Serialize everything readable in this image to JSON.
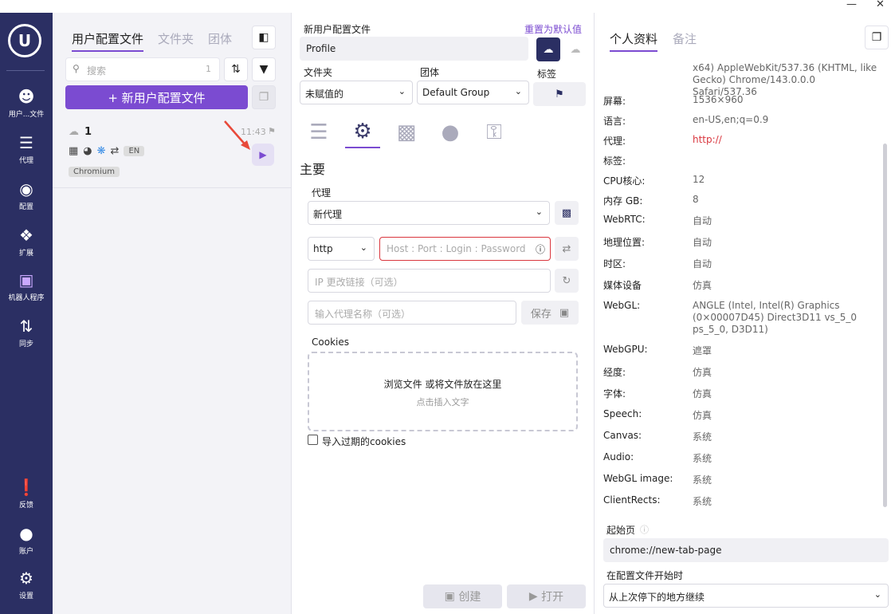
{
  "window": {
    "minimize": "—",
    "close": "✕"
  },
  "nav": {
    "items": [
      {
        "label": "用户...文件",
        "icon": "users-icon"
      },
      {
        "label": "代理",
        "icon": "proxy-icon"
      },
      {
        "label": "配置",
        "icon": "fingerprint-icon"
      },
      {
        "label": "扩展",
        "icon": "puzzle-icon"
      },
      {
        "label": "机器人程序",
        "icon": "lock-icon"
      },
      {
        "label": "同步",
        "icon": "sync-icon"
      },
      {
        "label": "反馈",
        "icon": "feedback-icon"
      },
      {
        "label": "账户",
        "icon": "account-icon"
      },
      {
        "label": "设置",
        "icon": "gear-icon"
      }
    ]
  },
  "profiles": {
    "tabs": [
      "用户配置文件",
      "文件夹",
      "团体"
    ],
    "search_placeholder": "搜索",
    "search_count": "1",
    "new_button": "+ 新用户配置文件",
    "card": {
      "name": "1",
      "time": "11:43",
      "lang_chip": "EN",
      "browser_chip": "Chromium"
    }
  },
  "editor": {
    "title_label": "新用户配置文件",
    "reset_link": "重置为默认值",
    "profile_name": "Profile",
    "folder_label": "文件夹",
    "folder_value": "未赋值的",
    "group_label": "团体",
    "group_value": "Default Group",
    "tag_label": "标签",
    "section_title": "主要",
    "proxy_label": "代理",
    "proxy_value": "新代理",
    "protocol": "http",
    "host_placeholder": "Host : Port : Login : Password",
    "ip_change_placeholder": "IP 更改链接（可选）",
    "proxy_name_placeholder": "输入代理名称（可选）",
    "save_label": "保存",
    "cookies_label": "Cookies",
    "drop_line1": "浏览文件 或将文件放在这里",
    "drop_line2": "点击插入文字",
    "import_expired": "导入过期的cookies",
    "create_label": "创建",
    "open_label": "打开"
  },
  "overview": {
    "tabs": [
      "个人资料",
      "备注"
    ],
    "ua_tail": "x64) AppleWebKit/537.36 (KHTML, like Gecko) Chrome/143.0.0.0 Safari/537.36",
    "rows": [
      {
        "k": "屏幕:",
        "v": "1536×960"
      },
      {
        "k": "语言:",
        "v": "en-US,en;q=0.9"
      },
      {
        "k": "代理:",
        "v": "http://"
      },
      {
        "k": "标签:",
        "v": ""
      },
      {
        "k": "CPU核心:",
        "v": "12"
      },
      {
        "k": "内存 GB:",
        "v": "8"
      },
      {
        "k": "WebRTC:",
        "v": "自动"
      },
      {
        "k": "地理位置:",
        "v": "自动"
      },
      {
        "k": "时区:",
        "v": "自动"
      },
      {
        "k": "媒体设备",
        "v": "仿真"
      },
      {
        "k": "WebGL:",
        "v": "ANGLE (Intel, Intel(R) Graphics (0×00007D45) Direct3D11 vs_5_0 ps_5_0, D3D11)"
      },
      {
        "k": "WebGPU:",
        "v": "遮罩"
      },
      {
        "k": "经度:",
        "v": "仿真"
      },
      {
        "k": "字体:",
        "v": "仿真"
      },
      {
        "k": "Speech:",
        "v": "仿真"
      },
      {
        "k": "Canvas:",
        "v": "系统"
      },
      {
        "k": "Audio:",
        "v": "系统"
      },
      {
        "k": "WebGL image:",
        "v": "系统"
      },
      {
        "k": "ClientRects:",
        "v": "系统"
      }
    ],
    "start_page_label": "起始页",
    "start_page_value": "chrome://new-tab-page",
    "on_start_label": "在配置文件开始时",
    "on_start_value": "从上次停下的地方继续"
  },
  "colors": {
    "accent": "#7b4bd1",
    "nav_bg": "#2b2f63",
    "proxy_red": "#d9363e"
  }
}
